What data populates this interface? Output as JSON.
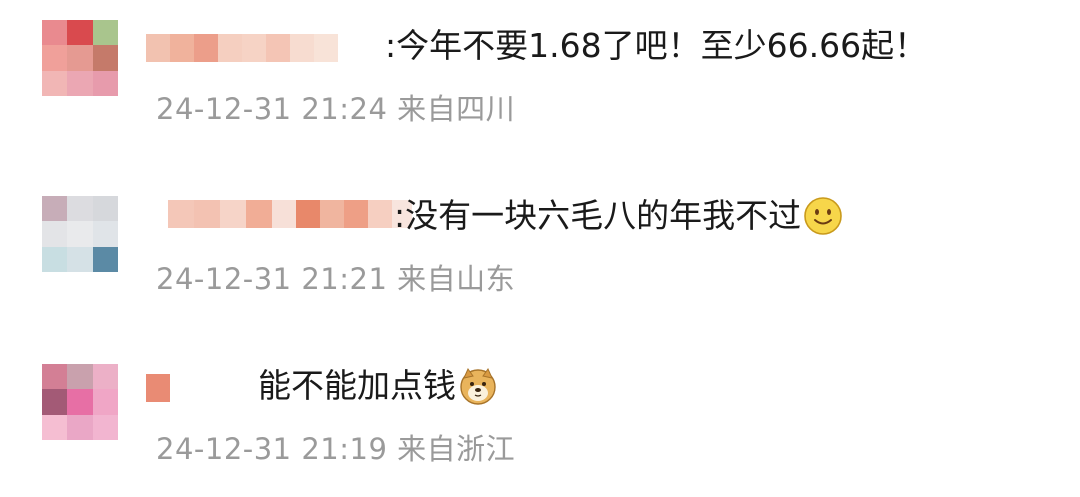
{
  "comments": [
    {
      "text": ":今年不要1.68了吧！至少66.66起！",
      "time": "24-12-31 21:24",
      "location": "来自四川",
      "emoji": "",
      "avatar_colors": [
        "#e98a8f",
        "#d94a4e",
        "#a9c58d",
        "#f0a09a",
        "#e59a92",
        "#c57a6a",
        "#f1b6b5",
        "#eba7b3",
        "#e79bac"
      ],
      "nick_colors": [
        "#f2c2b0",
        "#f0b29c",
        "#ec9e8a",
        "#f5cfc0",
        "#f6d3c5",
        "#f4c5b5",
        "#f7dcd0",
        "#f8e3d8"
      ]
    },
    {
      "text": ":没有一块六毛八的年我不过",
      "time": "24-12-31 21:21",
      "location": "来自山东",
      "emoji": "smile",
      "avatar_colors": [
        "#c7adb8",
        "#dcdce0",
        "#d6d8dc",
        "#e3e4e7",
        "#e9eaec",
        "#e0e4e8",
        "#c8dee2",
        "#d5e1e6",
        "#5b8aa5"
      ],
      "nick_colors": [
        "#f4c7b8",
        "#f3c2b2",
        "#f6d4c8",
        "#f1ad96",
        "#f7e0d8",
        "#e8886a",
        "#f0b59f",
        "#ee9f86",
        "#f6cfc1",
        "#f8e5de"
      ]
    },
    {
      "text": "能不能加点钱",
      "time": "24-12-31 21:19",
      "location": "来自浙江",
      "emoji": "doge",
      "avatar_colors": [
        "#d37f95",
        "#c9a1ad",
        "#ecb0c7",
        "#a35a76",
        "#e76fa5",
        "#f0a6c6",
        "#f5bed2",
        "#eaa7c6",
        "#f2b5d0"
      ],
      "nick_colors": [
        "#e98b74"
      ]
    }
  ]
}
